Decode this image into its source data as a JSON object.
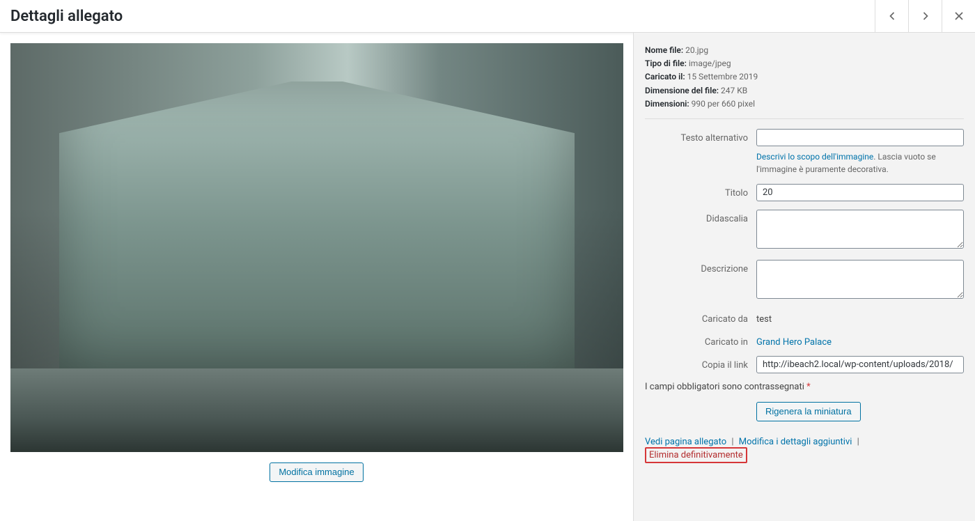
{
  "header": {
    "title": "Dettagli allegato"
  },
  "meta": {
    "filename_label": "Nome file:",
    "filename_value": "20.jpg",
    "filetype_label": "Tipo di file:",
    "filetype_value": "image/jpeg",
    "uploaded_on_label": "Caricato il:",
    "uploaded_on_value": "15 Settembre 2019",
    "filesize_label": "Dimensione del file:",
    "filesize_value": "247 KB",
    "dimensions_label": "Dimensioni:",
    "dimensions_value": "990 per 660 pixel"
  },
  "fields": {
    "alt_text": {
      "label": "Testo alternativo",
      "value": "",
      "help_link": "Descrivi lo scopo dell'immagine",
      "help_rest": ". Lascia vuoto se l'immagine è puramente decorativa."
    },
    "title": {
      "label": "Titolo",
      "value": "20"
    },
    "caption": {
      "label": "Didascalia",
      "value": ""
    },
    "description": {
      "label": "Descrizione",
      "value": ""
    },
    "uploaded_by": {
      "label": "Caricato da",
      "value": "test"
    },
    "uploaded_to": {
      "label": "Caricato in",
      "value": "Grand Hero Palace"
    },
    "copy_link": {
      "label": "Copia il link",
      "value": "http://ibeach2.local/wp-content/uploads/2018/"
    }
  },
  "required_note": {
    "text": "I campi obbligatori sono contrassegnati ",
    "ast": "*"
  },
  "buttons": {
    "edit_image": "Modifica immagine",
    "regenerate": "Rigenera la miniatura"
  },
  "actions": {
    "view": "Vedi pagina allegato",
    "edit_more": "Modifica i dettagli aggiuntivi",
    "delete": "Elimina definitivamente",
    "sep": "|"
  }
}
